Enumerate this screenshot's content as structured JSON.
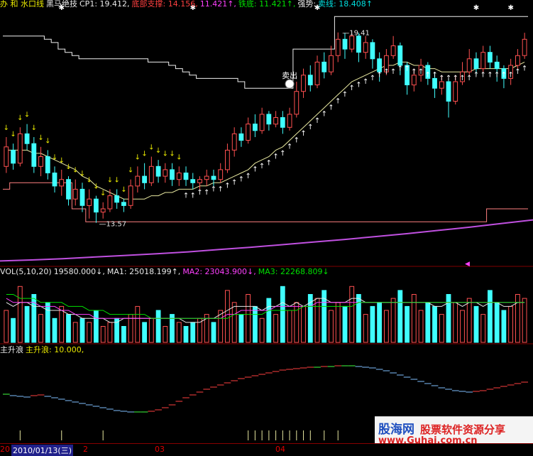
{
  "price_header": {
    "items": [
      {
        "text": "办 和 水口线",
        "color": "#e8e800"
      },
      {
        "text": "黑马绝技",
        "color": "#e8e8e8"
      },
      {
        "text": "CP1: 19.412,",
        "color": "#e8e8e8"
      },
      {
        "text": "底部支撑: 14.156,",
        "color": "#ff4040"
      },
      {
        "text": "11.421↑,",
        "color": "#ff40ff"
      },
      {
        "text": "铁底: 11.421↑,",
        "color": "#00e000"
      },
      {
        "text": "强势:",
        "color": "#e8e8e8"
      },
      {
        "text": "卖线: 18.408↑",
        "color": "#00e0e0"
      }
    ]
  },
  "price_annotations": {
    "high_label": "19.41",
    "low_label": "13.57",
    "sell_label": "卖出"
  },
  "vol_header": {
    "items": [
      {
        "text": "VOL(5,10,20)",
        "color": "#e8e8e8"
      },
      {
        "text": "19580.000↓,",
        "color": "#e8e8e8"
      },
      {
        "text": "MA1: 25018.199↑,",
        "color": "#e8e8e8"
      },
      {
        "text": "MA2: 23043.900↓,",
        "color": "#ff40ff"
      },
      {
        "text": "MA3: 22268.809↓",
        "color": "#00e000"
      }
    ]
  },
  "ind_header": {
    "items": [
      {
        "text": "主升浪",
        "color": "#e8e8e8"
      },
      {
        "text": "主升浪: 10.000,",
        "color": "#e8e800"
      }
    ]
  },
  "x_axis": {
    "labels": [
      {
        "text": "20",
        "at": 0
      },
      {
        "text": "2",
        "at": 1
      },
      {
        "text": "03",
        "at": 2
      },
      {
        "text": "04",
        "at": 3
      }
    ],
    "cursor_date": "2010/01/13(三)"
  },
  "watermark": {
    "site": "股海网",
    "tagline": "股票软件资源分享",
    "url": "www.Guhai.com.cn"
  },
  "colors": {
    "up": "#ff5050",
    "down": "#40ffff",
    "ma": "#e8e8a0",
    "long_ma": "#c050e0",
    "support": "#ff8080",
    "arrow_up": "#ffffff",
    "arrow_down": "#e8e800",
    "ind_up": "#ff4040",
    "ind_down": "#80c0ff",
    "ind_flat": "#40ff40"
  },
  "chart_data": {
    "type": "candlestick",
    "price_range": [
      12.3,
      20.1
    ],
    "candles": [
      {
        "o": 15.3,
        "c": 15.9,
        "h": 16.2,
        "l": 15.1
      },
      {
        "o": 15.8,
        "c": 15.4,
        "h": 16.0,
        "l": 15.2
      },
      {
        "o": 15.4,
        "c": 16.3,
        "h": 16.5,
        "l": 15.3
      },
      {
        "o": 16.3,
        "c": 16.0,
        "h": 16.6,
        "l": 15.8
      },
      {
        "o": 16.0,
        "c": 15.3,
        "h": 16.2,
        "l": 15.1
      },
      {
        "o": 15.3,
        "c": 15.6,
        "h": 15.9,
        "l": 15.0
      },
      {
        "o": 15.6,
        "c": 15.1,
        "h": 15.8,
        "l": 14.9
      },
      {
        "o": 15.1,
        "c": 14.7,
        "h": 15.3,
        "l": 14.5
      },
      {
        "o": 14.7,
        "c": 14.9,
        "h": 15.2,
        "l": 14.4
      },
      {
        "o": 14.9,
        "c": 14.3,
        "h": 15.0,
        "l": 14.1
      },
      {
        "o": 14.3,
        "c": 14.6,
        "h": 14.9,
        "l": 14.1
      },
      {
        "o": 14.6,
        "c": 14.1,
        "h": 14.8,
        "l": 13.9
      },
      {
        "o": 14.1,
        "c": 14.3,
        "h": 14.6,
        "l": 13.7
      },
      {
        "o": 14.3,
        "c": 13.9,
        "h": 14.4,
        "l": 13.57
      },
      {
        "o": 13.9,
        "c": 14.0,
        "h": 14.2,
        "l": 13.7
      },
      {
        "o": 14.0,
        "c": 14.4,
        "h": 14.6,
        "l": 13.9
      },
      {
        "o": 14.4,
        "c": 14.2,
        "h": 14.6,
        "l": 14.0
      },
      {
        "o": 14.2,
        "c": 14.1,
        "h": 14.3,
        "l": 13.9
      },
      {
        "o": 14.1,
        "c": 14.7,
        "h": 14.9,
        "l": 14.0
      },
      {
        "o": 14.7,
        "c": 15.0,
        "h": 15.3,
        "l": 14.5
      },
      {
        "o": 15.0,
        "c": 14.8,
        "h": 15.4,
        "l": 14.6
      },
      {
        "o": 14.8,
        "c": 15.3,
        "h": 15.6,
        "l": 14.7
      },
      {
        "o": 15.3,
        "c": 15.0,
        "h": 15.5,
        "l": 14.8
      },
      {
        "o": 15.0,
        "c": 15.2,
        "h": 15.4,
        "l": 14.8
      },
      {
        "o": 15.2,
        "c": 14.9,
        "h": 15.4,
        "l": 14.7
      },
      {
        "o": 14.9,
        "c": 15.1,
        "h": 15.3,
        "l": 14.7
      },
      {
        "o": 15.1,
        "c": 14.9,
        "h": 15.3,
        "l": 14.7
      },
      {
        "o": 14.9,
        "c": 14.8,
        "h": 15.1,
        "l": 14.6
      },
      {
        "o": 14.8,
        "c": 14.9,
        "h": 15.0,
        "l": 14.6
      },
      {
        "o": 14.9,
        "c": 15.0,
        "h": 15.2,
        "l": 14.7
      },
      {
        "o": 15.0,
        "c": 14.9,
        "h": 15.2,
        "l": 14.7
      },
      {
        "o": 14.9,
        "c": 15.2,
        "h": 15.4,
        "l": 14.8
      },
      {
        "o": 15.2,
        "c": 15.8,
        "h": 16.0,
        "l": 15.1
      },
      {
        "o": 15.8,
        "c": 16.3,
        "h": 16.5,
        "l": 15.6
      },
      {
        "o": 16.3,
        "c": 16.1,
        "h": 16.5,
        "l": 15.9
      },
      {
        "o": 16.1,
        "c": 16.6,
        "h": 16.8,
        "l": 16.0
      },
      {
        "o": 16.6,
        "c": 16.4,
        "h": 16.9,
        "l": 16.2
      },
      {
        "o": 16.4,
        "c": 16.9,
        "h": 17.1,
        "l": 16.3
      },
      {
        "o": 16.9,
        "c": 16.6,
        "h": 17.0,
        "l": 16.4
      },
      {
        "o": 16.6,
        "c": 16.8,
        "h": 17.0,
        "l": 16.5
      },
      {
        "o": 16.8,
        "c": 16.5,
        "h": 17.0,
        "l": 16.3
      },
      {
        "o": 16.5,
        "c": 16.9,
        "h": 17.1,
        "l": 16.4
      },
      {
        "o": 16.9,
        "c": 17.6,
        "h": 17.9,
        "l": 16.8
      },
      {
        "o": 17.6,
        "c": 18.1,
        "h": 18.3,
        "l": 17.4
      },
      {
        "o": 18.1,
        "c": 17.8,
        "h": 18.4,
        "l": 17.6
      },
      {
        "o": 17.8,
        "c": 18.5,
        "h": 18.7,
        "l": 17.7
      },
      {
        "o": 18.5,
        "c": 18.2,
        "h": 18.8,
        "l": 18.0
      },
      {
        "o": 18.2,
        "c": 18.7,
        "h": 19.0,
        "l": 18.1
      },
      {
        "o": 18.7,
        "c": 19.2,
        "h": 19.41,
        "l": 18.5
      },
      {
        "o": 19.2,
        "c": 18.9,
        "h": 19.4,
        "l": 18.6
      },
      {
        "o": 18.9,
        "c": 19.3,
        "h": 19.4,
        "l": 18.8
      },
      {
        "o": 19.3,
        "c": 18.8,
        "h": 19.4,
        "l": 18.5
      },
      {
        "o": 18.8,
        "c": 19.1,
        "h": 19.3,
        "l": 18.6
      },
      {
        "o": 19.1,
        "c": 18.6,
        "h": 19.2,
        "l": 18.3
      },
      {
        "o": 18.6,
        "c": 18.2,
        "h": 18.8,
        "l": 17.9
      },
      {
        "o": 18.2,
        "c": 18.7,
        "h": 18.9,
        "l": 18.1
      },
      {
        "o": 18.7,
        "c": 19.0,
        "h": 19.3,
        "l": 18.6
      },
      {
        "o": 19.0,
        "c": 18.4,
        "h": 19.1,
        "l": 18.1
      },
      {
        "o": 18.4,
        "c": 17.8,
        "h": 18.5,
        "l": 17.5
      },
      {
        "o": 17.8,
        "c": 18.1,
        "h": 18.3,
        "l": 17.6
      },
      {
        "o": 18.1,
        "c": 18.4,
        "h": 18.6,
        "l": 17.9
      },
      {
        "o": 18.4,
        "c": 18.0,
        "h": 18.5,
        "l": 17.8
      },
      {
        "o": 18.0,
        "c": 17.7,
        "h": 18.2,
        "l": 17.4
      },
      {
        "o": 17.7,
        "c": 17.9,
        "h": 18.1,
        "l": 17.5
      },
      {
        "o": 17.9,
        "c": 17.3,
        "h": 18.0,
        "l": 16.8
      },
      {
        "o": 17.3,
        "c": 17.9,
        "h": 18.1,
        "l": 17.2
      },
      {
        "o": 17.9,
        "c": 18.2,
        "h": 18.5,
        "l": 17.8
      },
      {
        "o": 18.2,
        "c": 18.6,
        "h": 18.9,
        "l": 18.1
      },
      {
        "o": 18.6,
        "c": 18.3,
        "h": 18.8,
        "l": 18.1
      },
      {
        "o": 18.3,
        "c": 18.8,
        "h": 19.0,
        "l": 18.2
      },
      {
        "o": 18.8,
        "c": 18.5,
        "h": 19.0,
        "l": 18.3
      },
      {
        "o": 18.5,
        "c": 18.3,
        "h": 18.7,
        "l": 17.9
      },
      {
        "o": 18.3,
        "c": 18.0,
        "h": 18.4,
        "l": 17.7
      },
      {
        "o": 18.0,
        "c": 18.4,
        "h": 18.6,
        "l": 17.8
      },
      {
        "o": 18.4,
        "c": 18.7,
        "h": 18.9,
        "l": 18.3
      },
      {
        "o": 18.7,
        "c": 19.2,
        "h": 19.4,
        "l": 18.6
      }
    ],
    "ma_line": [
      15.8,
      15.8,
      15.8,
      15.8,
      15.7,
      15.7,
      15.6,
      15.5,
      15.4,
      15.3,
      15.2,
      15.0,
      14.9,
      14.7,
      14.6,
      14.5,
      14.4,
      14.3,
      14.3,
      14.3,
      14.3,
      14.4,
      14.4,
      14.5,
      14.5,
      14.6,
      14.6,
      14.6,
      14.7,
      14.7,
      14.8,
      14.8,
      14.9,
      15.0,
      15.1,
      15.2,
      15.4,
      15.5,
      15.6,
      15.8,
      15.9,
      16.1,
      16.3,
      16.5,
      16.7,
      16.9,
      17.1,
      17.3,
      17.5,
      17.7,
      17.9,
      18.0,
      18.1,
      18.2,
      18.3,
      18.4,
      18.4,
      18.5,
      18.5,
      18.4,
      18.4,
      18.3,
      18.3,
      18.2,
      18.2,
      18.2,
      18.2,
      18.2,
      18.3,
      18.3,
      18.3,
      18.3,
      18.3,
      18.3,
      18.4,
      18.5
    ],
    "long_ma": [
      12.4,
      12.43,
      12.47,
      12.52,
      12.57,
      12.62,
      12.68,
      12.75,
      12.82,
      12.9,
      12.98,
      13.06,
      13.15,
      13.24,
      13.34,
      13.44,
      13.55,
      13.66
    ],
    "sell_line": [
      19.3,
      19.3,
      19.3,
      19.3,
      19.3,
      19.3,
      19.2,
      19.1,
      18.9,
      18.8,
      18.7,
      18.6,
      18.6,
      18.6,
      18.6,
      18.6,
      18.6,
      18.6,
      18.6,
      18.6,
      18.6,
      18.5,
      18.5,
      18.5,
      18.4,
      18.3,
      18.2,
      18.1,
      18.0,
      18.0,
      18.0,
      18.0,
      18.0,
      18.0,
      17.9,
      17.7,
      17.7,
      17.7,
      17.7,
      17.7,
      17.7,
      17.7,
      18.9,
      18.9,
      18.9,
      18.9,
      18.9,
      18.9,
      19.9,
      19.9,
      19.9,
      19.9,
      19.9,
      19.9,
      19.9,
      19.9,
      19.9,
      19.9,
      19.9,
      19.9,
      19.9,
      19.9,
      19.9,
      19.9,
      19.9,
      19.9,
      19.9,
      19.9,
      19.9,
      19.9,
      19.9,
      19.9,
      19.9,
      19.9,
      19.9,
      19.9
    ],
    "support_line": [
      14.6,
      14.8,
      14.8,
      14.8,
      14.8,
      14.8,
      14.8,
      14.8,
      14.8,
      14.8,
      14.0,
      14.0,
      13.6,
      13.6,
      13.6,
      13.6,
      13.6,
      13.6,
      13.6,
      13.6,
      13.6,
      13.6,
      13.6,
      13.6,
      13.6,
      13.6,
      13.6,
      13.6,
      13.6,
      13.6,
      13.6,
      13.6,
      13.6,
      13.6,
      13.6,
      13.6,
      13.6,
      13.6,
      13.6,
      13.6,
      13.6,
      13.6,
      13.6,
      13.6,
      13.6,
      13.6,
      13.6,
      13.6,
      13.6,
      13.6,
      13.6,
      13.6,
      13.6,
      13.6,
      13.6,
      13.6,
      13.6,
      13.6,
      13.6,
      13.6,
      13.6,
      13.6,
      13.6,
      13.6,
      13.6,
      13.6,
      13.6,
      13.6,
      13.6,
      13.6,
      14.0,
      14.0,
      14.0,
      14.0,
      14.0,
      14.0
    ],
    "volume": [
      8,
      6,
      14,
      9,
      12,
      7,
      10,
      6,
      9,
      7,
      5,
      6,
      5,
      8,
      4,
      5,
      6,
      4,
      7,
      9,
      5,
      6,
      8,
      4,
      7,
      5,
      4,
      5,
      6,
      7,
      5,
      8,
      13,
      10,
      7,
      12,
      9,
      6,
      11,
      7,
      14,
      8,
      10,
      9,
      12,
      11,
      13,
      8,
      10,
      9,
      14,
      12,
      7,
      9,
      10,
      8,
      11,
      13,
      9,
      12,
      8,
      10,
      9,
      7,
      12,
      10,
      8,
      11,
      9,
      7,
      13,
      10,
      8,
      9,
      12,
      11
    ],
    "vol_ma": [
      [
        10,
        9,
        10,
        10,
        9,
        9,
        8,
        8,
        8,
        7,
        7,
        6,
        6,
        6,
        6,
        5,
        5,
        6,
        6,
        6,
        6,
        6,
        6,
        6,
        6,
        6,
        5,
        5,
        5,
        6,
        6,
        7,
        8,
        9,
        9,
        9,
        9,
        8,
        9,
        9,
        10,
        9,
        10,
        9,
        10,
        11,
        11,
        10,
        10,
        10,
        11,
        11,
        10,
        10,
        10,
        10,
        10,
        10,
        10,
        10,
        10,
        10,
        9,
        9,
        10,
        10,
        9,
        10,
        10,
        9,
        10,
        10,
        9,
        9,
        10,
        10
      ],
      [
        11,
        10,
        10,
        10,
        10,
        9,
        9,
        9,
        8,
        8,
        7,
        7,
        7,
        6,
        6,
        6,
        6,
        6,
        6,
        6,
        6,
        6,
        6,
        6,
        6,
        6,
        6,
        6,
        6,
        6,
        6,
        6,
        7,
        7,
        8,
        8,
        8,
        8,
        8,
        9,
        9,
        9,
        9,
        9,
        9,
        10,
        10,
        10,
        10,
        10,
        10,
        10,
        10,
        10,
        10,
        10,
        10,
        10,
        10,
        10,
        10,
        10,
        10,
        10,
        10,
        10,
        10,
        10,
        10,
        10,
        10,
        10,
        10,
        10,
        10,
        10
      ],
      [
        12,
        12,
        11,
        11,
        11,
        10,
        10,
        10,
        10,
        9,
        9,
        9,
        8,
        8,
        8,
        7,
        7,
        7,
        7,
        7,
        7,
        6,
        6,
        6,
        6,
        6,
        6,
        6,
        6,
        6,
        6,
        6,
        6,
        7,
        7,
        7,
        7,
        7,
        8,
        8,
        8,
        8,
        8,
        9,
        9,
        9,
        9,
        9,
        9,
        9,
        9,
        10,
        10,
        10,
        10,
        10,
        10,
        10,
        10,
        10,
        10,
        10,
        10,
        10,
        10,
        10,
        10,
        10,
        10,
        10,
        10,
        10,
        10,
        10,
        10,
        10
      ]
    ],
    "vol_range": [
      0,
      16
    ],
    "wave": [
      6.5,
      6.3,
      6.2,
      6.1,
      6.3,
      6.4,
      6.2,
      6.0,
      5.8,
      5.6,
      5.4,
      5.2,
      5.0,
      4.8,
      4.6,
      4.4,
      4.2,
      4.1,
      4.0,
      4.0,
      4.0,
      4.1,
      4.3,
      4.6,
      5.0,
      5.5,
      6.0,
      6.4,
      6.8,
      7.2,
      7.5,
      7.8,
      8.1,
      8.4,
      8.7,
      8.9,
      9.1,
      9.3,
      9.5,
      9.7,
      9.9,
      10.0,
      10.1,
      10.2,
      10.3,
      10.3,
      10.4,
      10.4,
      10.5,
      10.5,
      10.5,
      10.4,
      10.3,
      10.2,
      10.0,
      9.8,
      9.5,
      9.2,
      8.9,
      8.6,
      8.3,
      8.0,
      7.7,
      7.4,
      7.2,
      7.0,
      6.9,
      6.8,
      6.9,
      7.0,
      7.2,
      7.4,
      7.6,
      7.8,
      8.0,
      8.2
    ],
    "wave_range": [
      2,
      12
    ]
  }
}
